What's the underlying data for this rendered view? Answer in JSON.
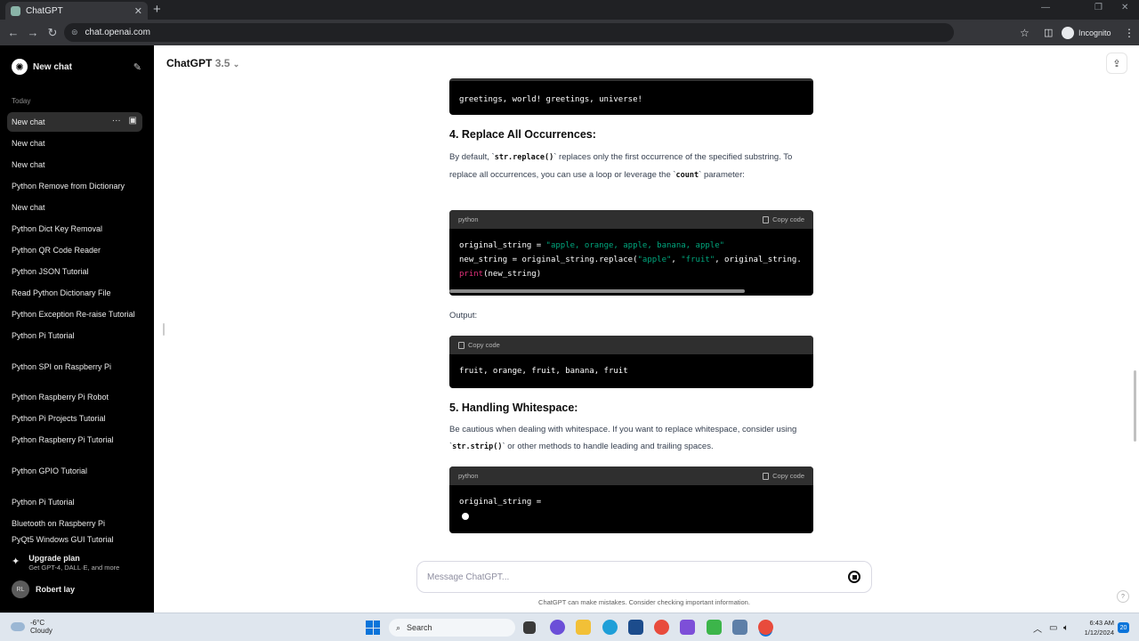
{
  "browser": {
    "tab_title": "ChatGPT",
    "tab_close": "✕",
    "new_tab": "+",
    "url": "chat.openai.com",
    "incognito_label": "Incognito"
  },
  "sidebar": {
    "new_chat_label": "New chat",
    "today_label": "Today",
    "items": [
      {
        "label": "New chat"
      },
      {
        "label": "New chat"
      },
      {
        "label": "New chat"
      },
      {
        "label": "Python Remove from Dictionary"
      },
      {
        "label": "New chat"
      },
      {
        "label": "Python Dict Key Removal"
      },
      {
        "label": "Python QR Code Reader"
      },
      {
        "label": "Python JSON Tutorial"
      },
      {
        "label": "Read Python Dictionary File"
      },
      {
        "label": "Python Exception Re-raise Tutorial"
      },
      {
        "label": "Python Pi Tutorial"
      },
      {
        "label": "Python SPI on Raspberry Pi"
      },
      {
        "label": "Python Raspberry Pi Robot"
      },
      {
        "label": "Python Pi Projects Tutorial"
      },
      {
        "label": "Python Raspberry Pi Tutorial"
      },
      {
        "label": "Python GPIO Tutorial"
      },
      {
        "label": "Python Pi Tutorial"
      },
      {
        "label": "Bluetooth on Raspberry Pi"
      },
      {
        "label": "PyQt5 Windows GUI Tutorial"
      }
    ],
    "upgrade_title": "Upgrade plan",
    "upgrade_sub": "Get GPT-4, DALL·E, and more",
    "user_initials": "RL",
    "user_name": "Robert lay"
  },
  "header": {
    "model_name": "ChatGPT",
    "model_version": "3.5",
    "chevron": "⌄"
  },
  "content": {
    "output1": "greetings, world! greetings, universe!",
    "h4": "4. Replace All Occurrences:",
    "p4_a": "By default, `",
    "p4_code1": "str.replace()",
    "p4_b": "` replaces only the first occurrence of the specified substring. To replace all occurrences, you can use a loop or leverage the `",
    "p4_code2": "count",
    "p4_c": "` parameter:",
    "code2_lang": "python",
    "copy_label": "Copy code",
    "code2_l1_var": "original_string = ",
    "code2_l1_str": "\"apple, orange, apple, banana, apple\"",
    "code2_l2_a": "new_string = original_string.replace(",
    "code2_l2_s1": "\"apple\"",
    "code2_l2_b": ", ",
    "code2_l2_s2": "\"fruit\"",
    "code2_l2_c": ", original_string.",
    "code2_l3_fn": "print",
    "code2_l3_rest": "(new_string)",
    "output_label": "Output:",
    "output2": "fruit, orange, fruit, banana, fruit",
    "h5": "5. Handling Whitespace:",
    "p5_a": "Be cautious when dealing with whitespace. If you want to replace whitespace, consider using `",
    "p5_code": "str.strip()",
    "p5_b": "` or other methods to handle leading and trailing spaces.",
    "code3_lang": "python",
    "code3_l1": "original_string = "
  },
  "composer": {
    "placeholder": "Message ChatGPT...",
    "disclaimer": "ChatGPT can make mistakes. Consider checking important information.",
    "help": "?"
  },
  "taskbar": {
    "temp": "-6°C",
    "condition": "Cloudy",
    "search": "Search",
    "time": "6:43 AM",
    "date": "1/12/2024",
    "notif_count": "20"
  }
}
